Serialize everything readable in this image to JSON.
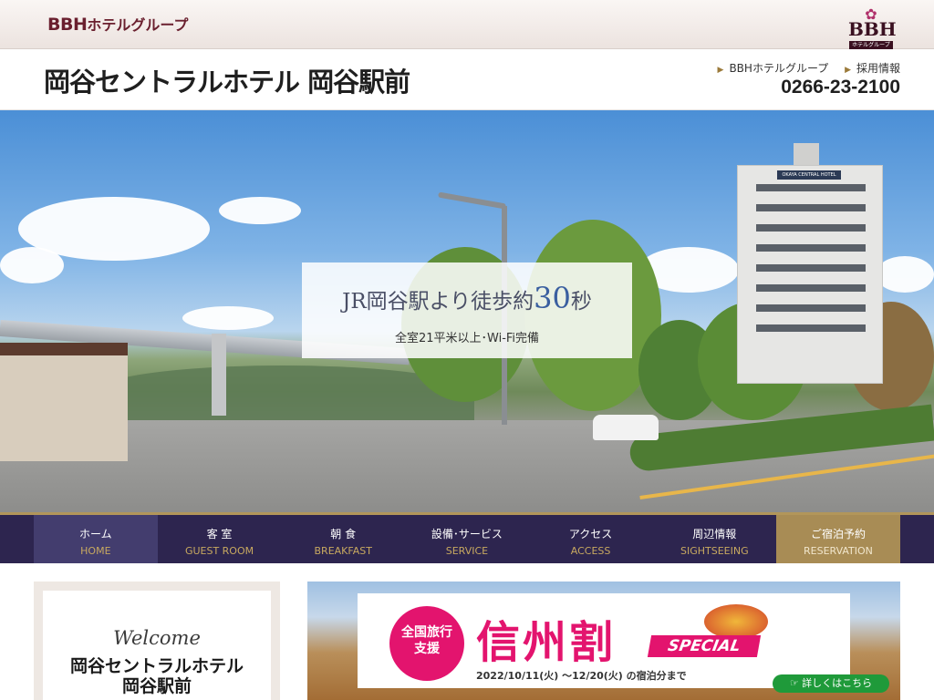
{
  "group": {
    "logo_text": "BBH",
    "logo_kata": "ホテルグループ",
    "badge_text": "BBH",
    "badge_sub": "ホテルグループ"
  },
  "header": {
    "hotel_name": "岡谷セントラルホテル 岡谷駅前",
    "links": [
      {
        "label": "BBHホテルグループ"
      },
      {
        "label": "採用情報"
      }
    ],
    "phone": "0266-23-2100"
  },
  "hero": {
    "title_prefix": "JR岡谷駅より徒歩約",
    "title_number": "30",
    "title_suffix": "秒",
    "subtitle": "全室21平米以上･Wi-Fi完備",
    "building_sign": "OKAYA CENTRAL HOTEL"
  },
  "nav": {
    "items": [
      {
        "jp": "ホーム",
        "en": "HOME"
      },
      {
        "jp": "客 室",
        "en": "GUEST ROOM"
      },
      {
        "jp": "朝 食",
        "en": "BREAKFAST"
      },
      {
        "jp": "設備･サービス",
        "en": "SERVICE"
      },
      {
        "jp": "アクセス",
        "en": "ACCESS"
      },
      {
        "jp": "周辺情報",
        "en": "SIGHTSEEING"
      },
      {
        "jp": "ご宿泊予約",
        "en": "RESERVATION"
      }
    ]
  },
  "welcome": {
    "word": "Welcome",
    "name_line1": "岡谷セントラルホテル",
    "name_line2": "岡谷駅前"
  },
  "banner": {
    "badge_line1": "全国旅行",
    "badge_line2": "支援",
    "title": "信州割",
    "special": "SPECIAL",
    "dates": "2022/10/11(火) 〜12/20(火) の宿泊分まで",
    "detail_button": "詳しくはこちら"
  }
}
